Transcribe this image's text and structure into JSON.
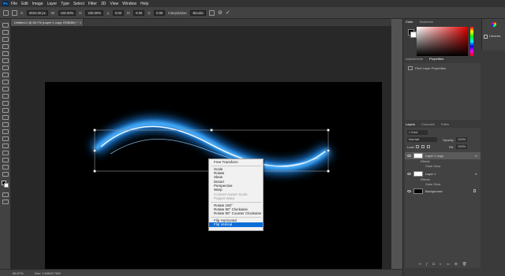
{
  "app": {
    "logo": "Ps"
  },
  "menu": [
    "File",
    "Edit",
    "Image",
    "Layer",
    "Type",
    "Select",
    "Filter",
    "3D",
    "View",
    "Window",
    "Help"
  ],
  "options": {
    "x_value": "3022.00 px",
    "w_value": "100.00%",
    "h_value": "100.00%",
    "angle_value": "0.00",
    "h_skew": "0.00",
    "v_skew": "0.00",
    "interpolation_label": "Interpolation:",
    "interpolation_value": "Bicubic"
  },
  "document": {
    "tab_title": "Untitled-1 @ 66.7% (Layer 1 copy, RGB/8#) *"
  },
  "panels": {
    "color_tabs": [
      "Color",
      "Swatches"
    ],
    "libraries_label": "Libraries",
    "prop_tabs": [
      "Adjustments",
      "Properties"
    ],
    "prop_heading": "Pixel Layer Properties",
    "layer_tabs": [
      "Layers",
      "Channels",
      "Paths"
    ],
    "layer_filter": "Kind",
    "blend_mode": "Normal",
    "opacity_label": "Opacity:",
    "opacity_value": "100%",
    "lock_label": "Lock:",
    "fill_label": "Fill:",
    "fill_value": "100%"
  },
  "layers": [
    {
      "name": "Layer 1 copy",
      "selected": true,
      "fx": "fx",
      "effects": [
        "Effects",
        "Outer Glow"
      ]
    },
    {
      "name": "Layer 1",
      "selected": false,
      "fx": "fx",
      "effects": [
        "Effects",
        "Outer Glow"
      ]
    },
    {
      "name": "Background",
      "selected": false,
      "fx": "",
      "effects": []
    }
  ],
  "status": {
    "zoom": "66.67%",
    "doc": "Doc: 2.64M/2.76M"
  },
  "context_menu": {
    "items": [
      {
        "label": "Free Transform",
        "state": "normal"
      },
      {
        "sep": true
      },
      {
        "label": "Scale",
        "state": "normal"
      },
      {
        "label": "Rotate",
        "state": "normal"
      },
      {
        "label": "Skew",
        "state": "normal"
      },
      {
        "label": "Distort",
        "state": "normal"
      },
      {
        "label": "Perspective",
        "state": "normal"
      },
      {
        "label": "Warp",
        "state": "normal"
      },
      {
        "label": "Content-Aware Scale",
        "state": "disabled"
      },
      {
        "label": "Puppet Warp",
        "state": "disabled"
      },
      {
        "sep": true
      },
      {
        "label": "Rotate 180°",
        "state": "normal"
      },
      {
        "label": "Rotate 90° Clockwise",
        "state": "normal"
      },
      {
        "label": "Rotate 90° Counter Clockwise",
        "state": "normal"
      },
      {
        "sep": true
      },
      {
        "label": "Flip Horizontal",
        "state": "normal"
      },
      {
        "label": "Flip Vertical",
        "state": "highlighted"
      }
    ]
  },
  "colors": {
    "accent": "#0b6cd8",
    "glow": "#1e90ff",
    "canvas": "#000000"
  }
}
